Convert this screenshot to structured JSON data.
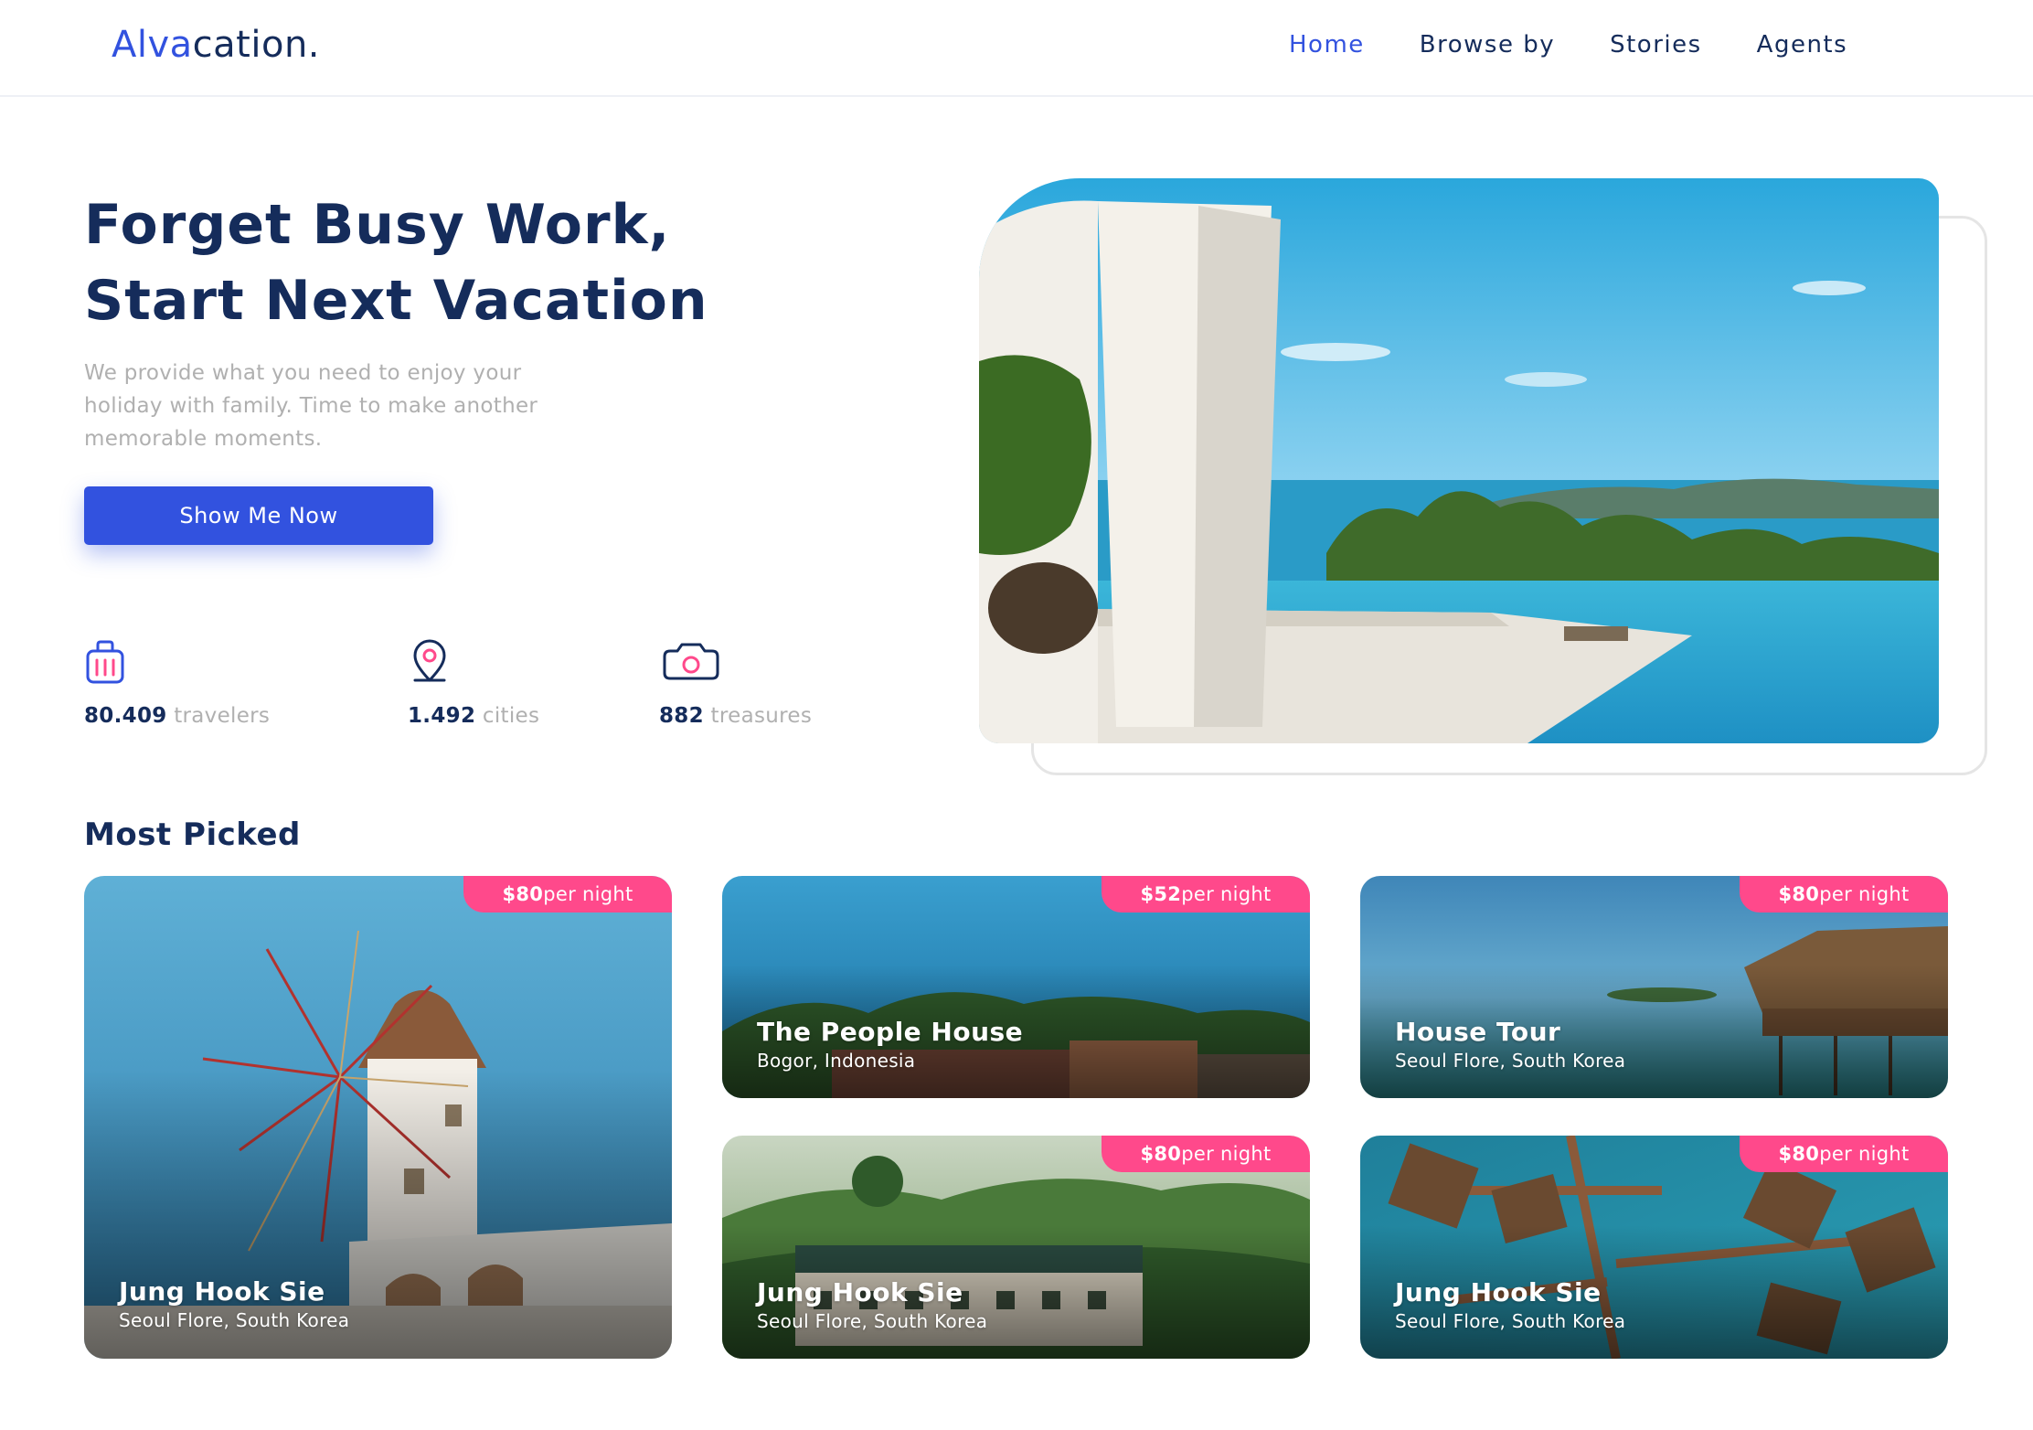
{
  "brand": {
    "logo_accent": "Alva",
    "logo_rest": "cation."
  },
  "nav": [
    {
      "label": "Home",
      "active": true
    },
    {
      "label": "Browse by",
      "active": false
    },
    {
      "label": "Stories",
      "active": false
    },
    {
      "label": "Agents",
      "active": false
    }
  ],
  "hero": {
    "title_line1": "Forget Busy Work,",
    "title_line2": "Start Next Vacation",
    "desc_line1": "We provide what you need to enjoy your",
    "desc_line2": "holiday with family. Time to make another",
    "desc_line3": "memorable moments.",
    "cta_label": "Show Me Now",
    "image_description": "pool-sea-view-photo"
  },
  "stats": [
    {
      "icon": "suitcase-icon",
      "value": "80.409",
      "label": "travelers"
    },
    {
      "icon": "location-pin-icon",
      "value": "1.492",
      "label": "cities"
    },
    {
      "icon": "camera-icon",
      "value": "882",
      "label": "treasures"
    }
  ],
  "most_picked": {
    "title": "Most Picked",
    "cards": [
      {
        "name": "Jung Hook Sie",
        "location": "Seoul Flore, South Korea",
        "price": "$80",
        "unit": "per night",
        "image": "windmill-photo"
      },
      {
        "name": "The People House",
        "location": "Bogor, Indonesia",
        "price": "$52",
        "unit": "per night",
        "image": "coastal-resort-photo"
      },
      {
        "name": "House Tour",
        "location": "Seoul Flore, South Korea",
        "price": "$80",
        "unit": "per night",
        "image": "overwater-hut-photo"
      },
      {
        "name": "Jung Hook Sie",
        "location": "Seoul Flore, South Korea",
        "price": "$80",
        "unit": "per night",
        "image": "mountain-village-photo"
      },
      {
        "name": "Jung Hook Sie",
        "location": "Seoul Flore, South Korea",
        "price": "$80",
        "unit": "per night",
        "image": "aerial-villas-photo"
      }
    ]
  },
  "colors": {
    "primary": "#3252df",
    "navy": "#152c5b",
    "muted": "#b0b0b0",
    "pink": "#ff498b"
  }
}
